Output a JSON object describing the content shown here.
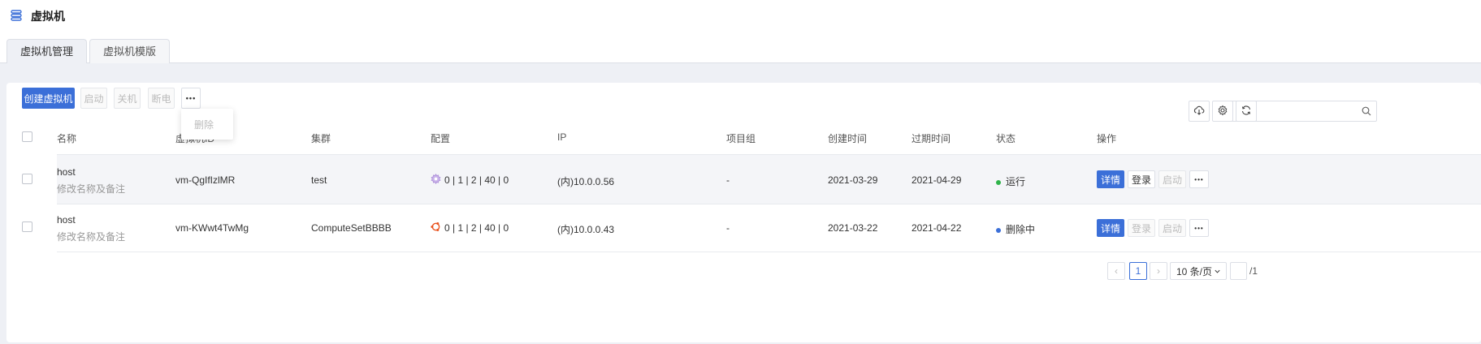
{
  "app": {
    "title": "虚拟机",
    "icon": "server-list-icon"
  },
  "tabs": [
    {
      "label": "虚拟机管理",
      "active": true
    },
    {
      "label": "虚拟机模版",
      "active": false
    }
  ],
  "toolbar": {
    "create_label": "创建虚拟机",
    "start_label": "启动",
    "shutdown_label": "关机",
    "poweroff_label": "断电",
    "more_label": "•••",
    "more_menu": {
      "delete_label": "删除"
    },
    "search": {
      "placeholder": "",
      "value": ""
    }
  },
  "table": {
    "columns": [
      "名称",
      "虚拟机ID",
      "集群",
      "配置",
      "IP",
      "项目组",
      "创建时间",
      "过期时间",
      "状态",
      "操作"
    ],
    "rows": [
      {
        "name": "host",
        "note": "修改名称及备注",
        "vm_id": "vm-QgIfIzlMR",
        "cluster": "test",
        "os_icon": "os-gear-icon",
        "config": "0 | 1 | 2 | 40 | 0",
        "ip": "(内)10.0.0.56",
        "project": "-",
        "created": "2021-03-29",
        "expires": "2021-04-29",
        "status": "运行",
        "status_color": "#2fb34a",
        "actions": {
          "detail": "详情",
          "login": "登录",
          "start": "启动",
          "more": "•••"
        }
      },
      {
        "name": "host",
        "note": "修改名称及备注",
        "vm_id": "vm-KWwt4TwMg",
        "cluster": "ComputeSetBBBB",
        "os_icon": "ubuntu-icon",
        "config": "0 | 1 | 2 | 40 | 0",
        "ip": "(内)10.0.0.43",
        "project": "-",
        "created": "2021-03-22",
        "expires": "2021-04-22",
        "status": "删除中",
        "status_color": "#3b6fd8",
        "actions": {
          "detail": "详情",
          "login": "登录",
          "start": "启动",
          "more": "•••"
        }
      }
    ]
  },
  "pagination": {
    "prev": "‹",
    "current_page": "1",
    "next": "›",
    "page_size": "10 条/页",
    "jump_value": "",
    "total_pages": "/1"
  },
  "colors": {
    "primary": "#3b6fd8",
    "running": "#2fb34a",
    "deleting": "#3b6fd8",
    "ubuntu": "#e95420",
    "config_gear": "#a98ad6"
  }
}
